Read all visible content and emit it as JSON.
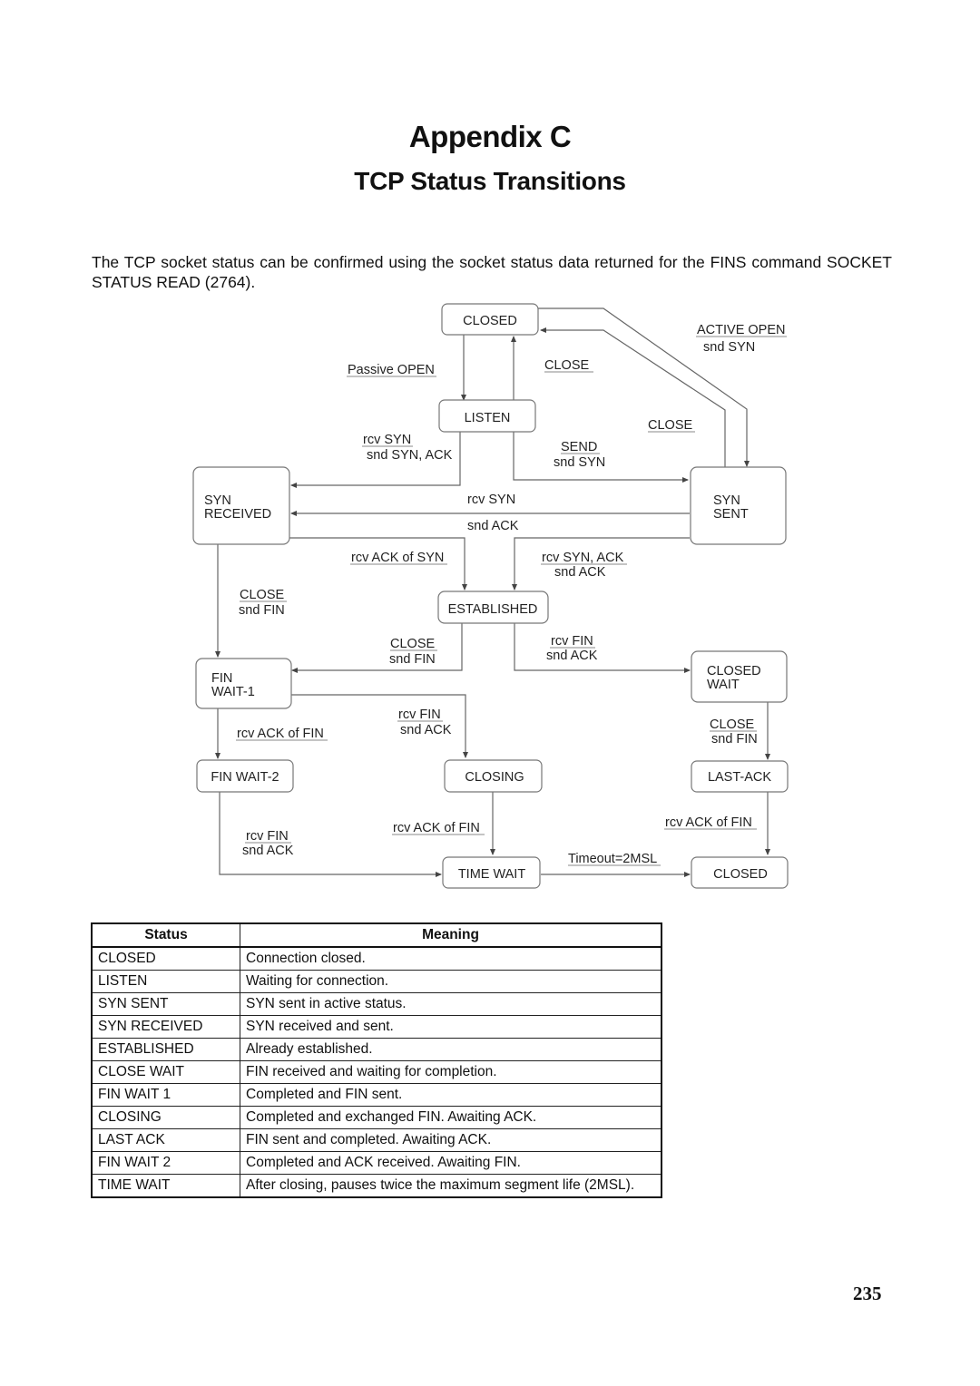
{
  "header": {
    "title": "Appendix C",
    "subtitle": "TCP Status Transitions"
  },
  "intro": "The TCP socket status can be confirmed using the socket status data returned for the FINS command SOCKET STATUS READ (2764).",
  "diagram": {
    "states": {
      "closed_top": "CLOSED",
      "listen": "LISTEN",
      "syn_received_1": "SYN",
      "syn_received_2": "RECEIVED",
      "syn_sent_1": "SYN",
      "syn_sent_2": "SENT",
      "established": "ESTABLISHED",
      "fin_wait1_1": "FIN",
      "fin_wait1_2": "WAIT-1",
      "closed_wait_1": "CLOSED",
      "closed_wait_2": "WAIT",
      "fin_wait2": "FIN WAIT-2",
      "closing": "CLOSING",
      "last_ack": "LAST-ACK",
      "time_wait": "TIME WAIT",
      "closed_bottom": "CLOSED"
    },
    "labels": {
      "active_open": "ACTIVE OPEN",
      "active_open_snd": "snd SYN",
      "passive_open": "Passive OPEN",
      "close_listen": "CLOSE",
      "close_synsent": "CLOSE",
      "rcv_syn_listen": "rcv SYN",
      "rcv_syn_listen_snd": "snd SYN, ACK",
      "send": "SEND",
      "send_snd": "snd SYN",
      "rcv_syn_simul": "rcv SYN",
      "rcv_syn_simul_snd": "snd ACK",
      "rcv_ack_of_syn": "rcv ACK of SYN",
      "rcv_syn_ack": "rcv SYN, ACK",
      "rcv_syn_ack_snd": "snd ACK",
      "close_synrcvd": "CLOSE",
      "close_synrcvd_snd": "snd FIN",
      "close_est": "CLOSE",
      "close_est_snd": "snd FIN",
      "rcv_fin_est": "rcv FIN",
      "rcv_fin_est_snd": "snd ACK",
      "rcv_fin_fw1": "rcv FIN",
      "rcv_fin_fw1_snd": "snd ACK",
      "rcv_ack_of_fin_fw1": "rcv ACK of FIN",
      "close_cw": "CLOSE",
      "close_cw_snd": "snd FIN",
      "rcv_fin_fw2": "rcv FIN",
      "rcv_fin_fw2_snd": "snd ACK",
      "rcv_ack_of_fin_closing": "rcv ACK of FIN",
      "rcv_ack_of_fin_lastack": "rcv ACK of FIN",
      "timeout": "Timeout=2MSL"
    }
  },
  "table": {
    "headers": [
      "Status",
      "Meaning"
    ],
    "rows": [
      [
        "CLOSED",
        "Connection closed."
      ],
      [
        "LISTEN",
        "Waiting for connection."
      ],
      [
        "SYN SENT",
        "SYN sent in active status."
      ],
      [
        "SYN RECEIVED",
        "SYN received and sent."
      ],
      [
        "ESTABLISHED",
        "Already established."
      ],
      [
        "CLOSE WAIT",
        "FIN received and waiting for completion."
      ],
      [
        "FIN WAIT 1",
        "Completed and FIN sent."
      ],
      [
        "CLOSING",
        "Completed and exchanged FIN. Awaiting ACK."
      ],
      [
        "LAST ACK",
        "FIN sent and completed. Awaiting ACK."
      ],
      [
        "FIN WAIT 2",
        "Completed and ACK received. Awaiting FIN."
      ],
      [
        "TIME WAIT",
        "After closing, pauses twice the maximum segment life (2MSL)."
      ]
    ]
  },
  "page_number": "235"
}
